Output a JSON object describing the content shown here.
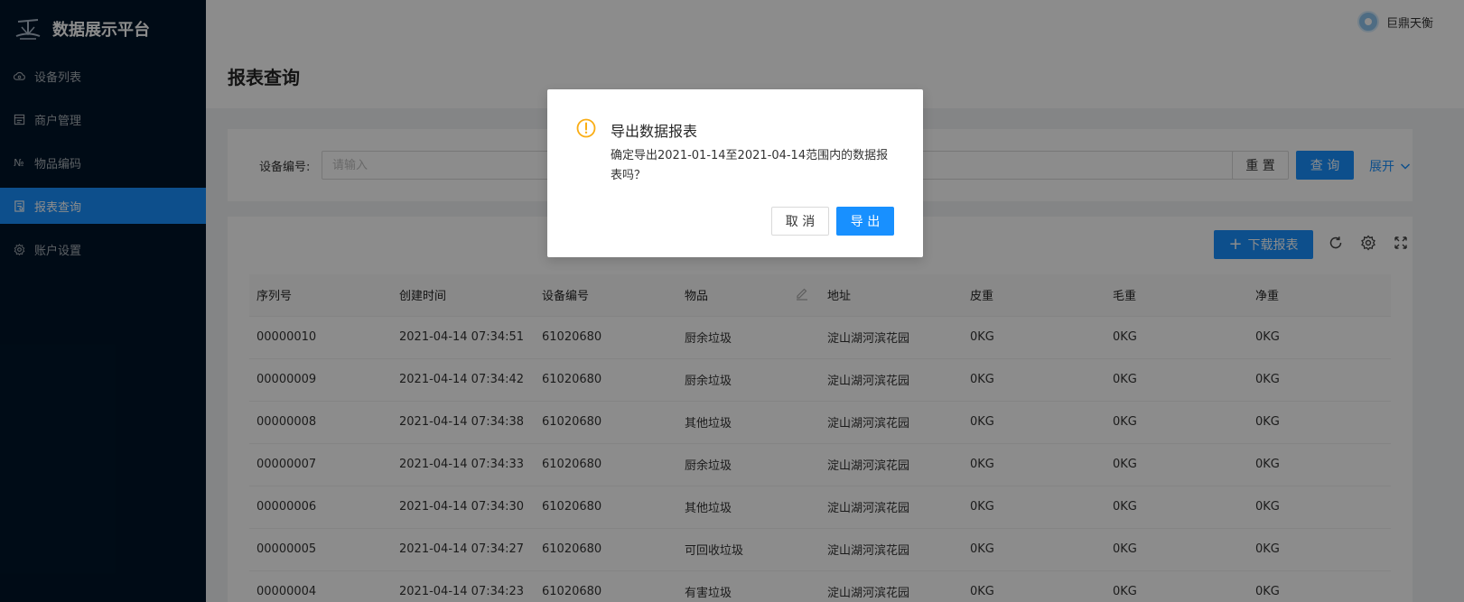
{
  "app": {
    "title": "数据展示平台"
  },
  "sidebar": {
    "items": [
      {
        "label": "设备列表",
        "icon": "cloud-icon",
        "active": false
      },
      {
        "label": "商户管理",
        "icon": "shop-icon",
        "active": false
      },
      {
        "label": "物品编码",
        "icon": "number-icon",
        "active": false
      },
      {
        "label": "报表查询",
        "icon": "report-icon",
        "active": true
      },
      {
        "label": "账户设置",
        "icon": "gear-icon",
        "active": false
      }
    ]
  },
  "header": {
    "username": "巨鼎天衡"
  },
  "page": {
    "title": "报表查询"
  },
  "search": {
    "label": "设备编号:",
    "placeholder": "请输入",
    "reset_label": "重 置",
    "query_label": "查 询",
    "expand_label": "展开"
  },
  "toolbar": {
    "download_label": "下载报表"
  },
  "table": {
    "columns": [
      "序列号",
      "创建时间",
      "设备编号",
      "物品",
      "地址",
      "皮重",
      "毛重",
      "净重"
    ],
    "rows": [
      [
        "00000010",
        "2021-04-14 07:34:51",
        "61020680",
        "厨余垃圾",
        "淀山湖河滨花园",
        "0KG",
        "0KG",
        "0KG"
      ],
      [
        "00000009",
        "2021-04-14 07:34:42",
        "61020680",
        "厨余垃圾",
        "淀山湖河滨花园",
        "0KG",
        "0KG",
        "0KG"
      ],
      [
        "00000008",
        "2021-04-14 07:34:38",
        "61020680",
        "其他垃圾",
        "淀山湖河滨花园",
        "0KG",
        "0KG",
        "0KG"
      ],
      [
        "00000007",
        "2021-04-14 07:34:33",
        "61020680",
        "厨余垃圾",
        "淀山湖河滨花园",
        "0KG",
        "0KG",
        "0KG"
      ],
      [
        "00000006",
        "2021-04-14 07:34:30",
        "61020680",
        "其他垃圾",
        "淀山湖河滨花园",
        "0KG",
        "0KG",
        "0KG"
      ],
      [
        "00000005",
        "2021-04-14 07:34:27",
        "61020680",
        "可回收垃圾",
        "淀山湖河滨花园",
        "0KG",
        "0KG",
        "0KG"
      ],
      [
        "00000004",
        "2021-04-14 07:34:23",
        "61020680",
        "有害垃圾",
        "淀山湖河滨花园",
        "0KG",
        "0KG",
        "0KG"
      ]
    ]
  },
  "modal": {
    "title": "导出数据报表",
    "content": "确定导出2021-01-14至2021-04-14范围内的数据报表吗？",
    "cancel_label": "取 消",
    "confirm_label": "导 出"
  },
  "colors": {
    "primary": "#1890ff",
    "sidebar": "#001529",
    "warning": "#faad14"
  }
}
